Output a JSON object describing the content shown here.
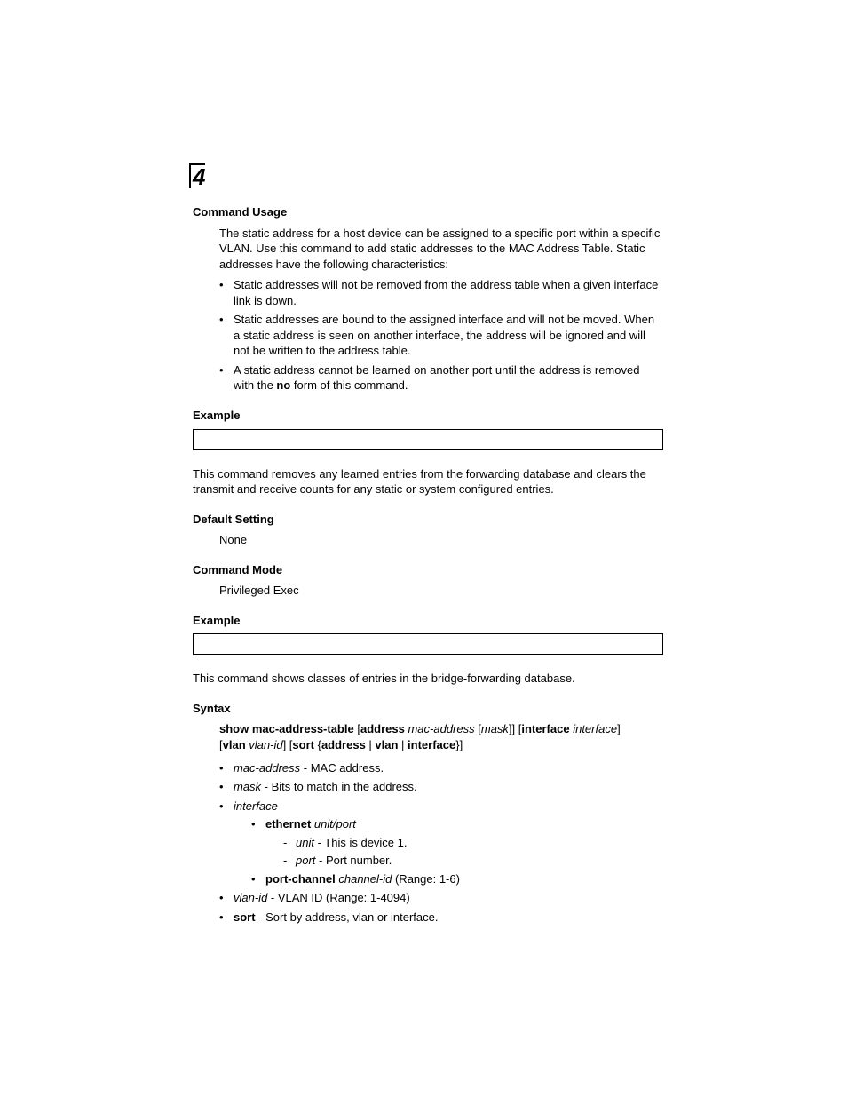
{
  "chapter_number": "4",
  "command_usage": {
    "heading": "Command Usage",
    "intro": "The static address for a host device can be assigned to a specific port within a specific VLAN. Use this command to add static addresses to the MAC Address Table. Static addresses have the following characteristics:",
    "bullets": [
      "Static addresses will not be removed from the address table when a given interface link is down.",
      "Static addresses are bound to the assigned interface and will not be moved. When a static address is seen on another interface, the address will be ignored and will not be written to the address table.",
      {
        "pre": "A static address cannot be learned on another port until the address is removed with the ",
        "bold": "no",
        "post": " form of this command."
      }
    ]
  },
  "example1_heading": "Example",
  "clear_desc": "This command removes any learned entries from the forwarding database and clears the transmit and receive counts for any static or system configured entries.",
  "default_setting": {
    "heading": "Default Setting",
    "value": "None"
  },
  "command_mode": {
    "heading": "Command Mode",
    "value": "Privileged Exec"
  },
  "example2_heading": "Example",
  "show_desc": "This command shows classes of entries in the bridge-forwarding database.",
  "syntax": {
    "heading": "Syntax",
    "line_parts": {
      "cmd": "show mac-address-table",
      "addr_kw": "address",
      "mac": "mac-address",
      "mask": "mask",
      "iface_kw": "interface",
      "iface": "interface",
      "vlan_kw": "vlan",
      "vlanid": "vlan-id",
      "sort_kw": "sort",
      "opt_addr": "address",
      "opt_vlan": "vlan",
      "opt_iface": "interface"
    },
    "items": {
      "mac_label": "mac-address",
      "mac_desc": " - MAC address.",
      "mask_label": "mask",
      "mask_desc": " - Bits to match in the address.",
      "iface_label": "interface",
      "eth_label": "ethernet",
      "eth_unit": "unit",
      "eth_port": "port",
      "unit_label": "unit",
      "unit_desc": " - This is device 1.",
      "port_label": "port",
      "port_desc": " - Port number.",
      "pc_label": "port-channel",
      "pc_arg": "channel-id",
      "pc_desc": " (Range: 1-6)",
      "vlan_label": "vlan-id",
      "vlan_desc": " - VLAN ID (Range: 1-4094)",
      "sort_label": "sort",
      "sort_desc": " - Sort by address, vlan or interface."
    }
  }
}
